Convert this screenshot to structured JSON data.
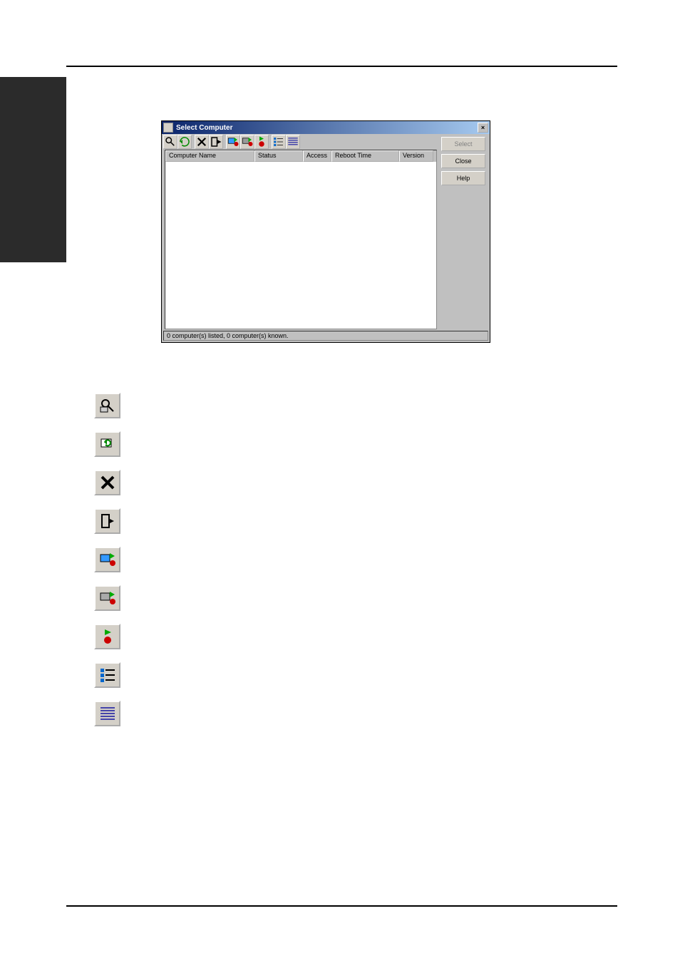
{
  "screenshot": {
    "title": "Select Computer",
    "columns": {
      "computer_name": "Computer Name",
      "status": "Status",
      "access": "Access",
      "reboot_time": "Reboot Time",
      "version": "Version"
    },
    "buttons": {
      "select": "Select",
      "close": "Close",
      "help": "Help"
    },
    "toolbar_icons": [
      "find-computer-icon",
      "refresh-icon",
      "delete-icon",
      "exit-icon",
      "shutdown-restart-icon",
      "shutdown-poweroff-icon",
      "abort-icon",
      "list-view-icon",
      "details-view-icon"
    ],
    "statusbar": "0 computer(s) listed, 0 computer(s) known."
  },
  "icon_legend": [
    {
      "name": "find-computer-icon"
    },
    {
      "name": "refresh-icon"
    },
    {
      "name": "delete-icon"
    },
    {
      "name": "exit-icon"
    },
    {
      "name": "shutdown-restart-icon"
    },
    {
      "name": "shutdown-poweroff-icon"
    },
    {
      "name": "abort-icon"
    },
    {
      "name": "list-view-icon"
    },
    {
      "name": "details-view-icon"
    }
  ]
}
